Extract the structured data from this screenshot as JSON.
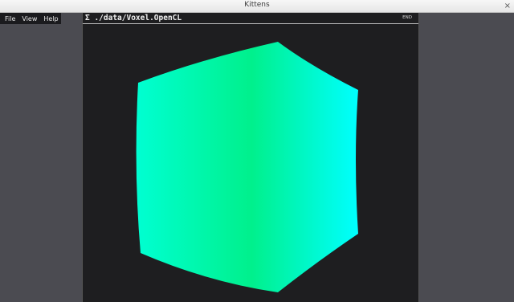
{
  "window": {
    "title": "Kittens",
    "close_symbol": "×"
  },
  "menu": {
    "items": [
      "File",
      "View",
      "Help"
    ]
  },
  "panel": {
    "title": "Σ ./data/Voxel.OpenCL",
    "end_label": "END"
  },
  "render": {
    "shape_icon": "cube-render",
    "colors": {
      "left": "#00ffd2",
      "center": "#00f08c",
      "right": "#00ffff"
    }
  }
}
